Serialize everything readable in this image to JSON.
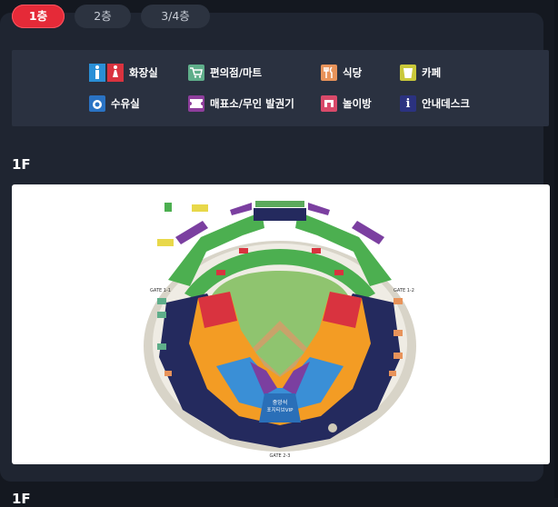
{
  "tabs": [
    {
      "label": "1층",
      "active": true
    },
    {
      "label": "2층",
      "active": false
    },
    {
      "label": "3/4층",
      "active": false
    }
  ],
  "legend": [
    {
      "label": "화장실",
      "icon": "restroom-icon",
      "color": "#2a8fd6"
    },
    {
      "label": "편의점/마트",
      "icon": "cart-icon",
      "color": "#5fae8a"
    },
    {
      "label": "식당",
      "icon": "fork-knife-icon",
      "color": "#e8935a"
    },
    {
      "label": "카페",
      "icon": "cup-icon",
      "color": "#c9c83a"
    },
    {
      "label": "수유실",
      "icon": "baby-icon",
      "color": "#2a73c4"
    },
    {
      "label": "매표소/무인 발권기",
      "icon": "ticket-icon",
      "color": "#8e3e9c"
    },
    {
      "label": "놀이방",
      "icon": "playroom-icon",
      "color": "#d94a6a"
    },
    {
      "label": "안내데스크",
      "icon": "info-icon",
      "color": "#2b3280"
    }
  ],
  "section_title": "1F",
  "next_section_title": "1F",
  "map": {
    "center_label_1": "중앙석",
    "center_label_2": "포지티브VIP",
    "gate_left": "GATE 1-1",
    "gate_right": "GATE 1-2",
    "gate_bottom": "GATE 2-3",
    "zone_colors": {
      "green": "#4caf50",
      "red": "#d9333f",
      "orange": "#f39c24",
      "navy": "#242a5e",
      "blue": "#3a8fd6",
      "purple": "#7b3fa0"
    }
  }
}
